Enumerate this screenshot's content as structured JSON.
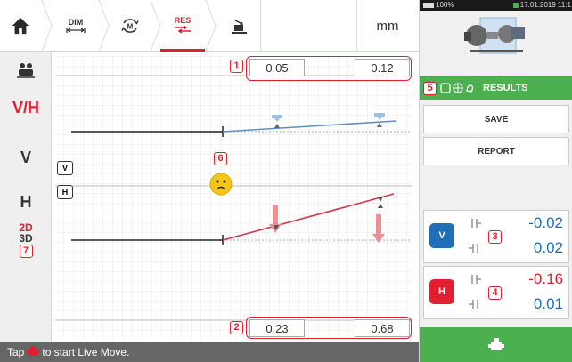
{
  "toolbar": {
    "dim_label": "DIM",
    "res_label": "RES",
    "unit": "mm"
  },
  "sidebar": {
    "vh_label": "V/H",
    "v_label": "V",
    "h_label": "H",
    "mode_2d": "2D",
    "mode_3d": "3D",
    "badge_7": "7"
  },
  "plot": {
    "top_values": [
      "0.05",
      "0.12"
    ],
    "bottom_values": [
      "0.23",
      "0.68"
    ],
    "badge_1": "1",
    "badge_2": "2",
    "badge_6": "6",
    "vertical_label": "V",
    "horizontal_label": "H"
  },
  "status": {
    "prefix": "Tap",
    "suffix": "to start Live Move."
  },
  "rightpanel": {
    "battery": "100%",
    "datetime": "17.01.2019 11:1",
    "badge_5": "5",
    "results_label": "RESULTS",
    "save_label": "SAVE",
    "report_label": "REPORT",
    "v_card": {
      "icon_label": "V",
      "badge": "3",
      "value_top": "-0.02",
      "value_bottom": "0.02"
    },
    "h_card": {
      "icon_label": "H",
      "badge": "4",
      "value_top": "-0.16",
      "value_bottom": "0.01"
    }
  },
  "colors": {
    "accent_red": "#e02030",
    "blue": "#1f6fb8",
    "green": "#4caf50",
    "status_gray": "#666666"
  }
}
